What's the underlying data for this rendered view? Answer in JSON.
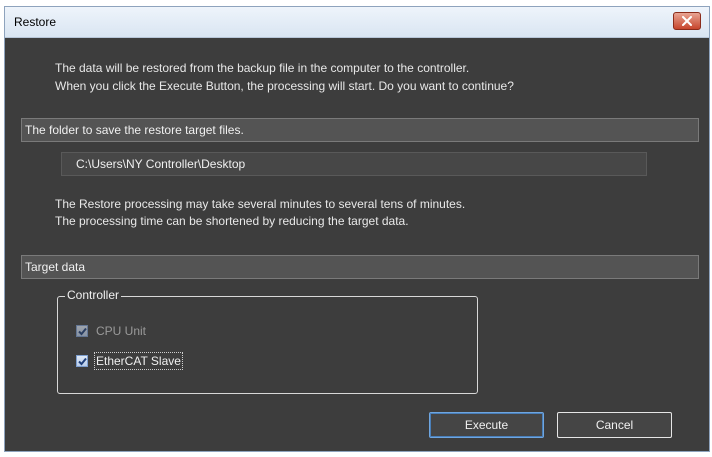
{
  "window": {
    "title": "Restore"
  },
  "intro": {
    "line1": "The data will be restored from the backup file in the computer to the controller.",
    "line2": "When you click the Execute Button, the processing will start. Do you want to continue?"
  },
  "folder_section": {
    "label": "The folder to save the restore target files.",
    "path_value": "C:\\Users\\NY Controller\\Desktop"
  },
  "notice": {
    "line1": "The Restore processing may take several minutes to several tens of minutes.",
    "line2": "The processing time can be shortened by reducing the target data."
  },
  "target_section": {
    "label": "Target data",
    "group_label": "Controller",
    "items": [
      {
        "label": "CPU Unit",
        "checked": true,
        "enabled": false
      },
      {
        "label": "EtherCAT Slave",
        "checked": true,
        "enabled": true
      }
    ]
  },
  "buttons": {
    "execute_label": "Execute",
    "cancel_label": "Cancel"
  },
  "icons": {
    "close": "close-icon",
    "check": "checkmark-icon"
  },
  "colors": {
    "dialog_background": "#3d3d3d",
    "section_bar": "#545454",
    "close_button": "#c7452c",
    "primary_button_border": "#6fa6e0"
  }
}
